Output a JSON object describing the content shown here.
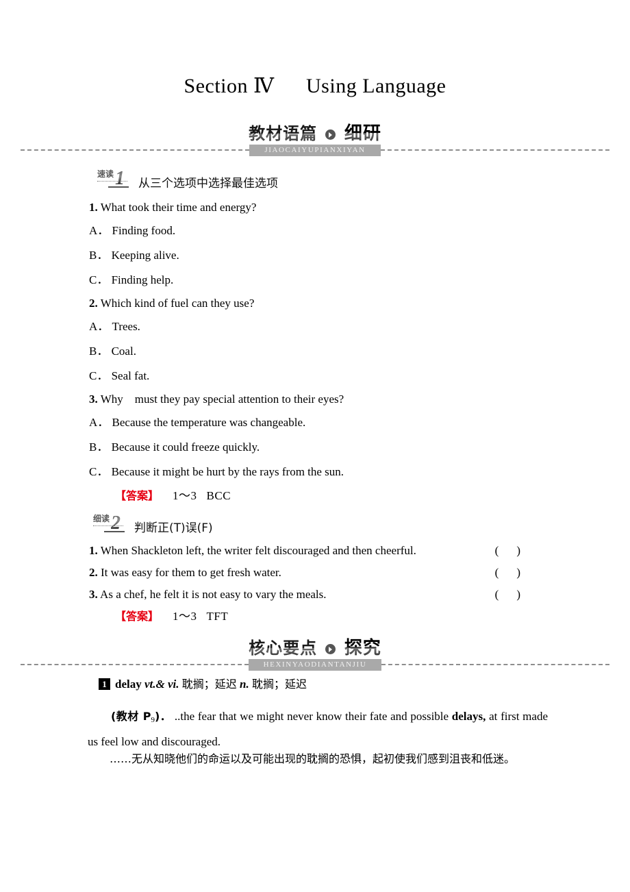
{
  "page": {
    "title_main": "Section",
    "title_numeral": "Ⅳ",
    "title_sub": "Using Language"
  },
  "sections": [
    {
      "cn_head_a": "教材语篇",
      "cn_head_b": "细研",
      "pinyin": "JIAOCAIYUPIANXIYAN"
    },
    {
      "cn_head_a": "核心要点",
      "cn_head_b": "探究",
      "pinyin": "HEXINYAODIANTANJIU"
    }
  ],
  "task1": {
    "badge_label": "速读",
    "badge_num": "1",
    "heading": "从三个选项中选择最佳选项",
    "questions": [
      {
        "num": "1.",
        "text": " What took their time and energy?",
        "options": [
          {
            "letter": "A．",
            "text": "Finding food."
          },
          {
            "letter": "B．",
            "text": "Keeping alive."
          },
          {
            "letter": "C．",
            "text": "Finding help."
          }
        ]
      },
      {
        "num": "2.",
        "text": " Which kind of fuel can they use?",
        "options": [
          {
            "letter": "A．",
            "text": "Trees."
          },
          {
            "letter": "B．",
            "text": "Coal."
          },
          {
            "letter": "C．",
            "text": "Seal fat."
          }
        ]
      },
      {
        "num": "3.",
        "text": " Why    must they pay special attention to their eyes?",
        "options": [
          {
            "letter": "A．",
            "text": "Because the temperature was changeable."
          },
          {
            "letter": "B．",
            "text": "Because it could freeze quickly."
          },
          {
            "letter": "C．",
            "text": "Because it might be hurt by the rays from the sun."
          }
        ]
      }
    ],
    "answer_tag": "【答案】",
    "answer_range": "1～3",
    "answer_value": "BCC"
  },
  "task2": {
    "badge_label": "细读",
    "badge_num": "2",
    "heading": "判断正(T)误(F)",
    "statements": [
      {
        "num": "1.",
        "text": " When Shackleton left, the writer felt discouraged and then cheerful."
      },
      {
        "num": "2.",
        "text": " It was easy for them to get fresh water."
      },
      {
        "num": "3.",
        "text": " As a chef, he felt it is not easy to vary the meals."
      }
    ],
    "blank_open": "(",
    "blank_close": ")",
    "answer_tag": "【答案】",
    "answer_range": "1～3",
    "answer_value": "TFT"
  },
  "entry": {
    "number": "1",
    "word": "delay",
    "pos1": "vt.& vi.",
    "meaning1": "耽搁；延迟",
    "pos2": "n.",
    "meaning2": "耽搁；延迟",
    "source_label": "(教材 P",
    "source_page": "9",
    "source_label_end": ")．",
    "example_before": " ..the fear that we might never know their fate and possible ",
    "example_bold": "delays,",
    "example_after": " at first made us feel low and discouraged.",
    "translation": "……无从知晓他们的命运以及可能出现的耽搁的恐惧，起初使我们感到沮丧和低迷。"
  },
  "colors": {
    "answer_tag": "#e60012",
    "pinyin_banner": "#a9a9a9",
    "dash_rule": "#8d8d8d"
  }
}
